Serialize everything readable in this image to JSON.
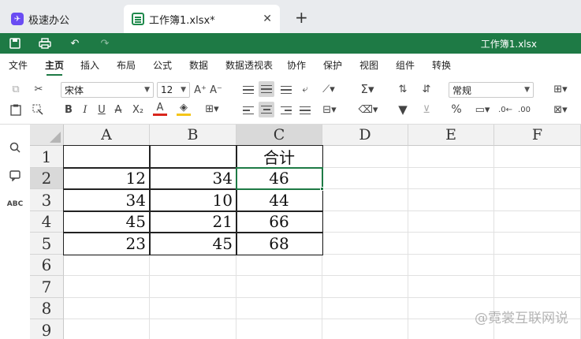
{
  "tabs": {
    "home_label": "极速办公",
    "doc_label": "工作簿1.xlsx*",
    "new_tab": "+"
  },
  "quickbar": {
    "title": "工作簿1.xlsx"
  },
  "menu": {
    "items": [
      "文件",
      "主页",
      "插入",
      "布局",
      "公式",
      "数据",
      "数据透视表",
      "协作",
      "保护",
      "视图",
      "组件",
      "转换"
    ],
    "active": "主页"
  },
  "toolbar": {
    "font_name": "宋体",
    "font_size": "12",
    "number_format": "常规",
    "grow_font": "A⁺",
    "shrink_font": "A⁻",
    "bold": "B",
    "italic": "I",
    "underline": "U",
    "strike": "A",
    "sub_super": "X₂",
    "font_color": "A",
    "percent": "%"
  },
  "grid": {
    "columns": [
      "A",
      "B",
      "C",
      "D",
      "E",
      "F"
    ],
    "rows": [
      "1",
      "2",
      "3",
      "4",
      "5",
      "6",
      "7",
      "8",
      "9"
    ],
    "c1": "合计",
    "values": [
      [
        "12",
        "34",
        "46"
      ],
      [
        "34",
        "10",
        "44"
      ],
      [
        "45",
        "21",
        "66"
      ],
      [
        "23",
        "45",
        "68"
      ]
    ],
    "selected_cell": "C2"
  },
  "watermark": "@霓裳互联网说"
}
